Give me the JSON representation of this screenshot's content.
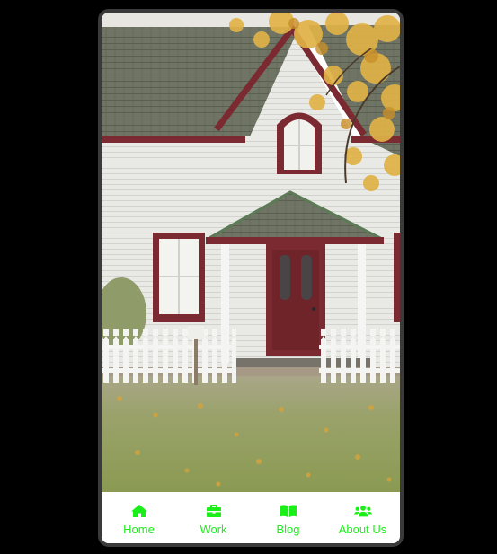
{
  "theme": {
    "accent": "#1aef1a",
    "nav_background": "#ffffff",
    "frame_border": "#3a3a3a",
    "page_background": "#000000"
  },
  "hero": {
    "subject": "white clapboard house with maroon trim, picket fence and autumn leaves"
  },
  "nav": {
    "items": [
      {
        "label": "Home",
        "icon": "home-icon"
      },
      {
        "label": "Work",
        "icon": "briefcase-icon"
      },
      {
        "label": "Blog",
        "icon": "book-icon"
      },
      {
        "label": "About Us",
        "icon": "users-icon"
      }
    ]
  }
}
